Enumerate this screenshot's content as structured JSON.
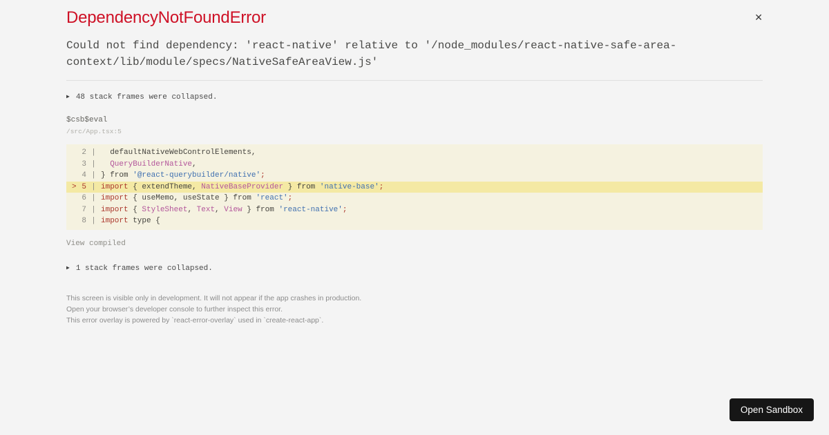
{
  "header": {
    "title": "DependencyNotFoundError",
    "close_icon": "✕"
  },
  "error_message": "Could not find dependency: 'react-native' relative to '/node_modules/react-native-safe-area-context/lib/module/specs/NativeSafeAreaView.js'",
  "stack": {
    "collapse_marker": "▶",
    "collapsed_top": "48 stack frames were collapsed.",
    "frame": {
      "function": "$csb$eval",
      "location": "/src/App.tsx:5"
    },
    "view_compiled": "View compiled",
    "collapsed_bottom": "1 stack frames were collapsed."
  },
  "code_frame": {
    "gutter_separator": "|",
    "highlighted_line_number": 5,
    "lines": [
      {
        "number": 2,
        "marker": "",
        "highlighted": false,
        "tokens": [
          {
            "text": "  defaultNativeWebControlElements,",
            "type": "plain"
          }
        ]
      },
      {
        "number": 3,
        "marker": "",
        "highlighted": false,
        "tokens": [
          {
            "text": "  ",
            "type": "plain"
          },
          {
            "text": "QueryBuilderNative",
            "type": "id"
          },
          {
            "text": ",",
            "type": "plain"
          }
        ]
      },
      {
        "number": 4,
        "marker": "",
        "highlighted": false,
        "tokens": [
          {
            "text": "} from ",
            "type": "plain"
          },
          {
            "text": "'@react-querybuilder/native'",
            "type": "str"
          },
          {
            "text": ";",
            "type": "kw"
          }
        ]
      },
      {
        "number": 5,
        "marker": ">",
        "highlighted": true,
        "tokens": [
          {
            "text": "import",
            "type": "kw"
          },
          {
            "text": " { extendTheme, ",
            "type": "plain"
          },
          {
            "text": "NativeBaseProvider",
            "type": "id"
          },
          {
            "text": " } from ",
            "type": "plain"
          },
          {
            "text": "'native-base'",
            "type": "str"
          },
          {
            "text": ";",
            "type": "kw"
          }
        ]
      },
      {
        "number": 6,
        "marker": "",
        "highlighted": false,
        "tokens": [
          {
            "text": "import",
            "type": "kw"
          },
          {
            "text": " { useMemo, useState } from ",
            "type": "plain"
          },
          {
            "text": "'react'",
            "type": "str"
          },
          {
            "text": ";",
            "type": "kw"
          }
        ]
      },
      {
        "number": 7,
        "marker": "",
        "highlighted": false,
        "tokens": [
          {
            "text": "import",
            "type": "kw"
          },
          {
            "text": " { ",
            "type": "plain"
          },
          {
            "text": "StyleSheet",
            "type": "id"
          },
          {
            "text": ", ",
            "type": "plain"
          },
          {
            "text": "Text",
            "type": "id"
          },
          {
            "text": ", ",
            "type": "plain"
          },
          {
            "text": "View",
            "type": "id"
          },
          {
            "text": " } from ",
            "type": "plain"
          },
          {
            "text": "'react-native'",
            "type": "str"
          },
          {
            "text": ";",
            "type": "kw"
          }
        ]
      },
      {
        "number": 8,
        "marker": "",
        "highlighted": false,
        "tokens": [
          {
            "text": "import",
            "type": "kw"
          },
          {
            "text": " type {",
            "type": "plain"
          }
        ]
      }
    ]
  },
  "footer": {
    "lines": [
      "This screen is visible only in development. It will not appear if the app crashes in production.",
      "Open your browser’s developer console to further inspect this error.",
      "This error overlay is powered by `react-error-overlay` used in `create-react-app`."
    ]
  },
  "open_sandbox": {
    "label": "Open Sandbox"
  },
  "colors": {
    "title": "#ce1126",
    "keyword": "#ab372c",
    "identifier": "#b3569b",
    "string": "#4070b0",
    "code_background": "#f5f2e0",
    "highlight_background": "#f4e9a4",
    "page_background": "#f4f4f4",
    "button_background": "#161616"
  }
}
